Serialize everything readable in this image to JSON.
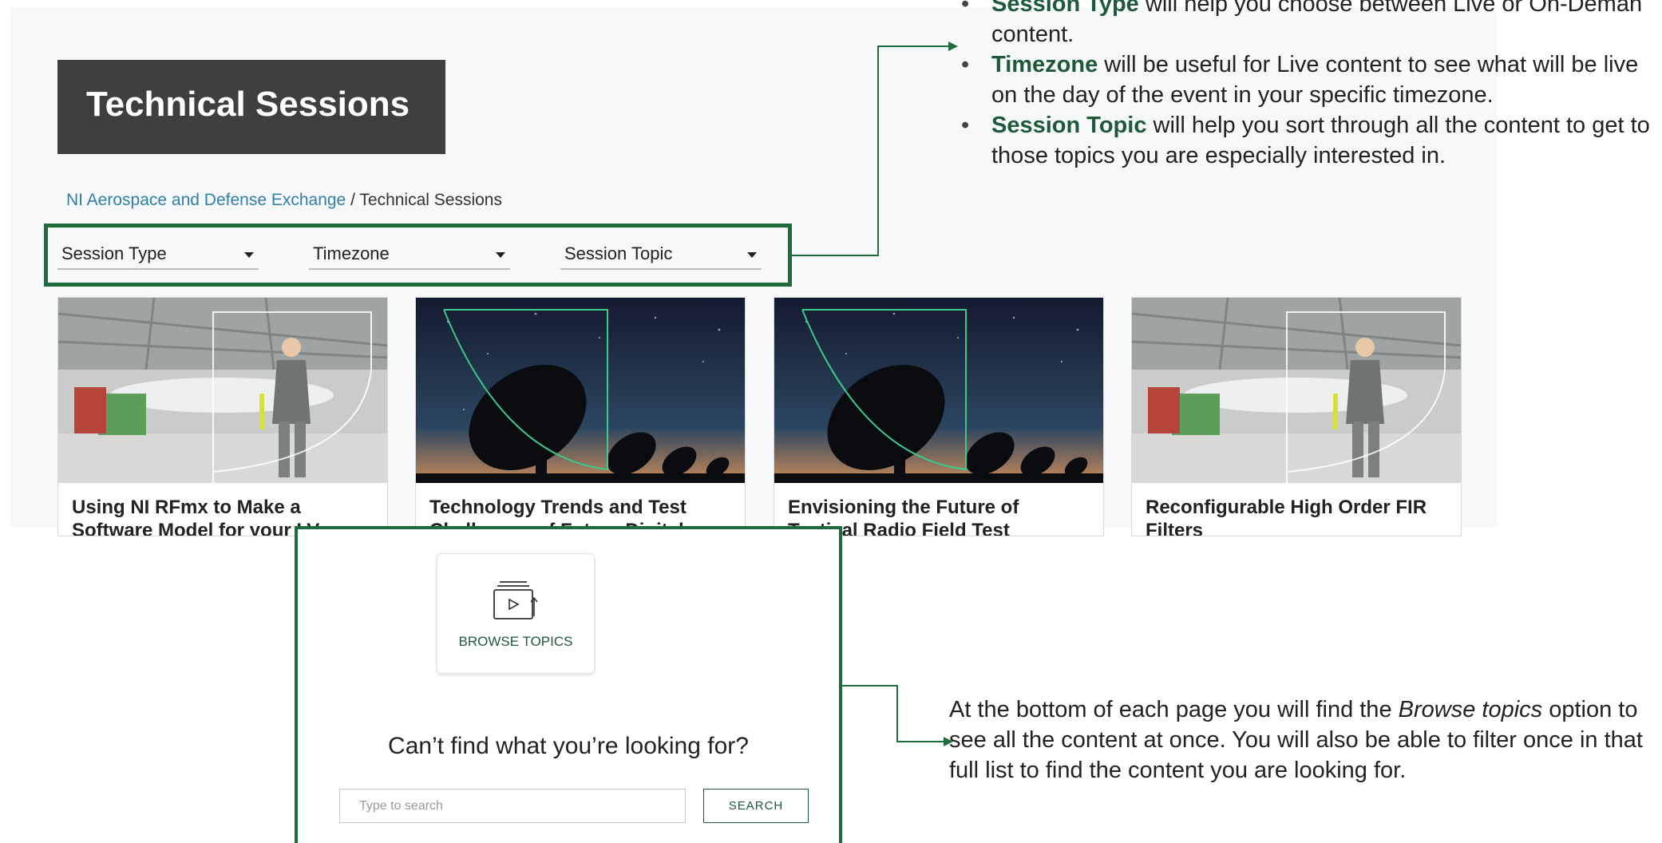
{
  "page": {
    "hero_title": "Technical Sessions",
    "breadcrumb": {
      "link": "NI Aerospace and Defense Exchange",
      "separator": "/",
      "current": "Technical Sessions"
    },
    "filters": [
      {
        "label": "Session Type"
      },
      {
        "label": "Timezone"
      },
      {
        "label": "Session Topic"
      }
    ],
    "cards": [
      {
        "title": "Using NI RFmx to Make a Software Model for your LV",
        "image": "hangar-worker"
      },
      {
        "title": "Technology Trends and Test Challenges of Future Digital",
        "image": "radio-telescope"
      },
      {
        "title": "Envisioning the Future of Tactical Radio Field Test",
        "image": "radio-telescope"
      },
      {
        "title": "Reconfigurable High Order FIR Filters",
        "image": "hangar-worker"
      }
    ]
  },
  "bottom": {
    "browse_label": "BROWSE TOPICS",
    "browse_icon": "browse-topics-icon",
    "heading": "Can’t find what you’re looking for?",
    "search_placeholder": "Type to search",
    "search_button": "SEARCH"
  },
  "annotations": {
    "top": [
      {
        "bold": "Session Type",
        "text": " will help you choose between Live or On-Deman content."
      },
      {
        "bold": "Timezone",
        "text": " will be useful for Live content to see what will be live on the day of the event in your specific timezone."
      },
      {
        "bold": "Session Topic",
        "text": " will help you sort through all the content to get to those topics you are especially interested in."
      }
    ],
    "bottom": {
      "pre": "At the bottom of each page you will find the ",
      "italic": "Browse topics",
      "post": " option to see all the content at once. You will also be able to filter once in that full list to find the content you are looking for."
    }
  },
  "colors": {
    "accent_green": "#1e6b3c",
    "hero_bg": "#3f3f3f",
    "link_blue": "#2f7fa6"
  }
}
